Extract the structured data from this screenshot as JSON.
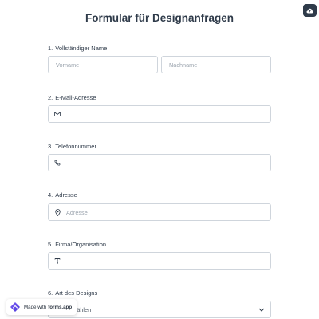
{
  "form": {
    "title": "Formular für Designanfragen"
  },
  "questions": {
    "q1": {
      "number": "1.",
      "label": "Vollständiger Name",
      "first_placeholder": "Vorname",
      "last_placeholder": "Nachname"
    },
    "q2": {
      "number": "2.",
      "label": "E-Mail-Adresse",
      "icon": "mail-icon",
      "placeholder": ""
    },
    "q3": {
      "number": "3.",
      "label": "Telefonnummer",
      "icon": "phone-icon",
      "placeholder": ""
    },
    "q4": {
      "number": "4.",
      "label": "Adresse",
      "icon": "location-pin-icon",
      "placeholder": "Adresse"
    },
    "q5": {
      "number": "5.",
      "label": "Firma/Organisation",
      "icon": "text-icon",
      "placeholder": ""
    },
    "q6": {
      "number": "6.",
      "label": "Art des Designs",
      "select_value": "wählen",
      "icon": "chevron-down-icon"
    }
  },
  "badge": {
    "prefix": "Made with",
    "brand": "forms.app"
  },
  "colors": {
    "accent": "#2f3b4a",
    "border": "#cfd5dc",
    "placeholder": "#9aa3ad"
  }
}
